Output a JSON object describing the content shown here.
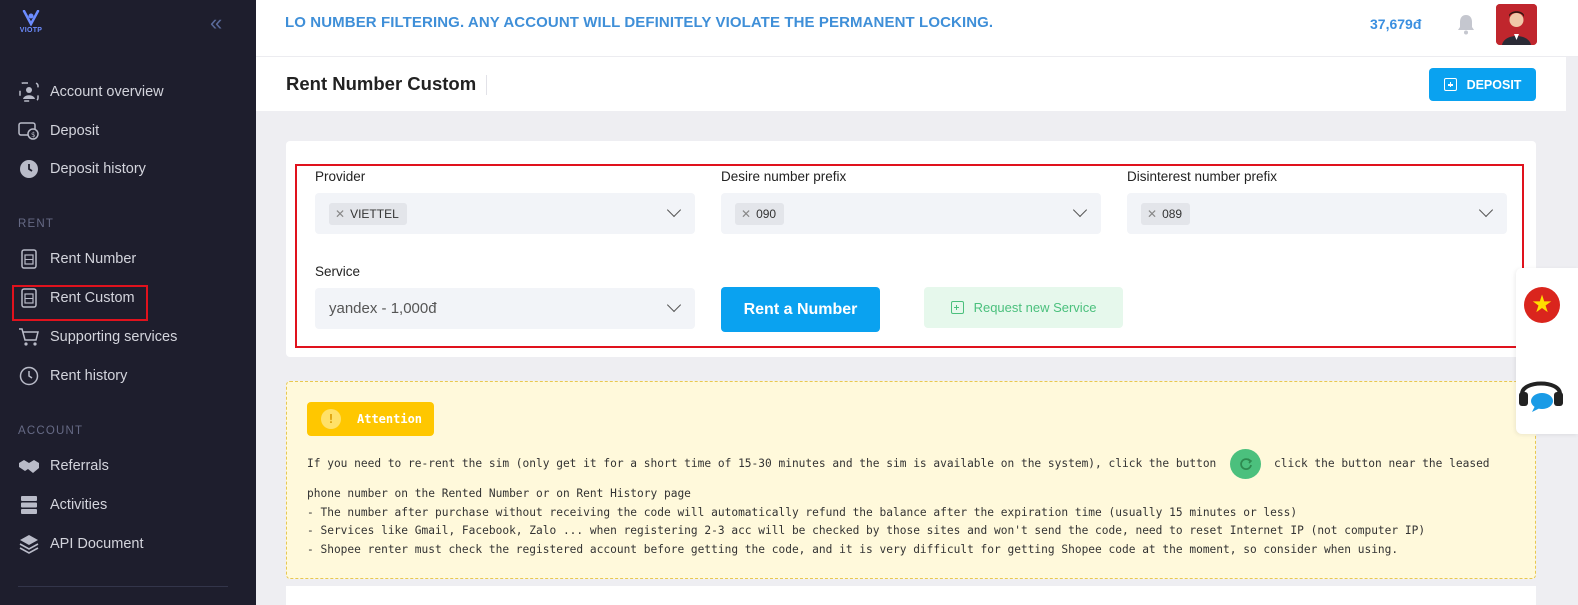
{
  "brand": {
    "logo_text": "VIOTP"
  },
  "sidebar": {
    "items_main": [
      {
        "label": "Account overview",
        "icon": "account-overview-icon"
      },
      {
        "label": "Deposit",
        "icon": "deposit-icon"
      },
      {
        "label": "Deposit history",
        "icon": "clock-icon"
      }
    ],
    "section_rent": "RENT",
    "items_rent": [
      {
        "label": "Rent Number",
        "icon": "sim-icon"
      },
      {
        "label": "Rent Custom",
        "icon": "sim-icon"
      },
      {
        "label": "Supporting services",
        "icon": "cart-icon"
      },
      {
        "label": "Rent history",
        "icon": "history-icon"
      }
    ],
    "section_account": "ACCOUNT",
    "items_account": [
      {
        "label": "Referrals",
        "icon": "handshake-icon"
      },
      {
        "label": "Activities",
        "icon": "list-icon"
      },
      {
        "label": "API Document",
        "icon": "layers-icon"
      }
    ]
  },
  "topbar": {
    "marquee": "LO NUMBER FILTERING. ANY ACCOUNT WILL DEFINITELY VIOLATE THE PERMANENT LOCKING.",
    "balance": "37,679đ"
  },
  "header": {
    "title": "Rent Number Custom",
    "deposit_label": "DEPOSIT"
  },
  "form": {
    "provider_label": "Provider",
    "provider_value": "VIETTEL",
    "prefix_label": "Desire number prefix",
    "prefix_value": "090",
    "disinterest_label": "Disinterest number prefix",
    "disinterest_value": "089",
    "service_label": "Service",
    "service_value": "yandex - 1,000đ",
    "rent_button": "Rent a Number",
    "request_button": "Request new Service"
  },
  "attention": {
    "badge": "Attention",
    "line1a": "If you need to re-rent the sim (only get it for a short time of 15-30 minutes and the sim is available on the system), click the button",
    "line1b": "click the button near the leased",
    "line2": "phone number on the Rented Number or on Rent History page",
    "line3": "- The number after purchase without receiving the code will automatically refund the balance after the expiration time (usually 15 minutes or less)",
    "line4": "- Services like Gmail, Facebook, Zalo ... when registering 2-3 acc will be checked by those sites and won't send the code, need to reset Internet IP (not computer IP)",
    "line5": "- Shopee renter must check the registered account before getting the code, and it is very difficult for getting Shopee code at the moment, so consider when using."
  },
  "colors": {
    "accent": "#0aa2f0",
    "sidebar_bg": "#1e1e2d",
    "highlight": "#e0121d",
    "success": "#4bc07d",
    "warning": "#ffc700"
  }
}
